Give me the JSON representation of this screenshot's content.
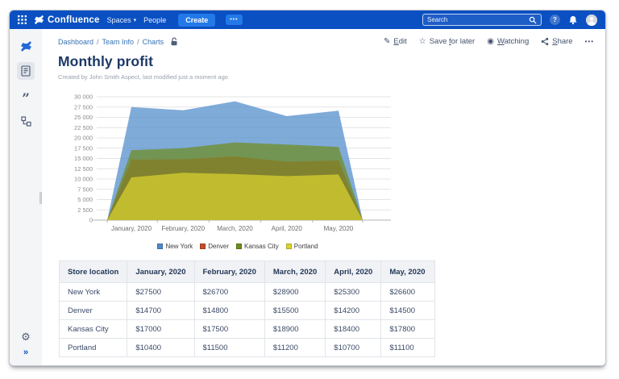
{
  "icons": {
    "chevron_down": "▾",
    "nav_more": "•••",
    "actions_more": "•••",
    "quote_glyph": "”",
    "gear_glyph": "⚙",
    "expand_glyph": "»",
    "help_glyph": "?"
  },
  "nav": {
    "product": "Confluence",
    "menu": [
      {
        "label": "Spaces"
      },
      {
        "label": "People"
      }
    ],
    "create_label": "Create",
    "search_placeholder": "Search"
  },
  "breadcrumb": {
    "item1": "Dashboard",
    "item2": "Team Info",
    "item3": "Charts",
    "sep1": "/",
    "sep2": "/"
  },
  "actions": {
    "edit": {
      "pre": "",
      "key": "E",
      "post": "dit"
    },
    "save": {
      "pre": "Save ",
      "key": "f",
      "post": "or later"
    },
    "watching": {
      "pre": "",
      "key": "W",
      "post": "atching"
    },
    "share": {
      "pre": "",
      "key": "S",
      "post": "hare"
    }
  },
  "page": {
    "title": "Monthly profit",
    "byline": "Created by John Smith Aspect, last modified just a moment ago"
  },
  "chart_data": {
    "type": "area",
    "title": "",
    "xlabel": "",
    "ylabel": "",
    "categories": [
      "January, 2020",
      "February, 2020",
      "March, 2020",
      "April, 2020",
      "May, 2020"
    ],
    "series": [
      {
        "name": "New York",
        "color": "#4e8acb",
        "values": [
          27500,
          26700,
          28900,
          25300,
          26600
        ]
      },
      {
        "name": "Denver",
        "color": "#c44d27",
        "values": [
          14700,
          14800,
          15500,
          14200,
          14500
        ]
      },
      {
        "name": "Kansas City",
        "color": "#6f8c1f",
        "values": [
          17000,
          17500,
          18900,
          18400,
          17800
        ]
      },
      {
        "name": "Portland",
        "color": "#d9d32f",
        "values": [
          10400,
          11500,
          11200,
          10700,
          11100
        ]
      }
    ],
    "ylim": [
      0,
      30000
    ],
    "ytick_step": 2500,
    "grid": true,
    "legend_position": "bottom",
    "fill_opacity": 0.72
  },
  "table": {
    "headers": [
      "Store location",
      "January, 2020",
      "February, 2020",
      "March, 2020",
      "April, 2020",
      "May, 2020"
    ],
    "rows": [
      {
        "label": "New York",
        "values": [
          "$27500",
          "$26700",
          "$28900",
          "$25300",
          "$26600"
        ]
      },
      {
        "label": "Denver",
        "values": [
          "$14700",
          "$14800",
          "$15500",
          "$14200",
          "$14500"
        ]
      },
      {
        "label": "Kansas City",
        "values": [
          "$17000",
          "$17500",
          "$18900",
          "$18400",
          "$17800"
        ]
      },
      {
        "label": "Portland",
        "values": [
          "$10400",
          "$11500",
          "$11200",
          "$10700",
          "$11100"
        ]
      }
    ]
  }
}
